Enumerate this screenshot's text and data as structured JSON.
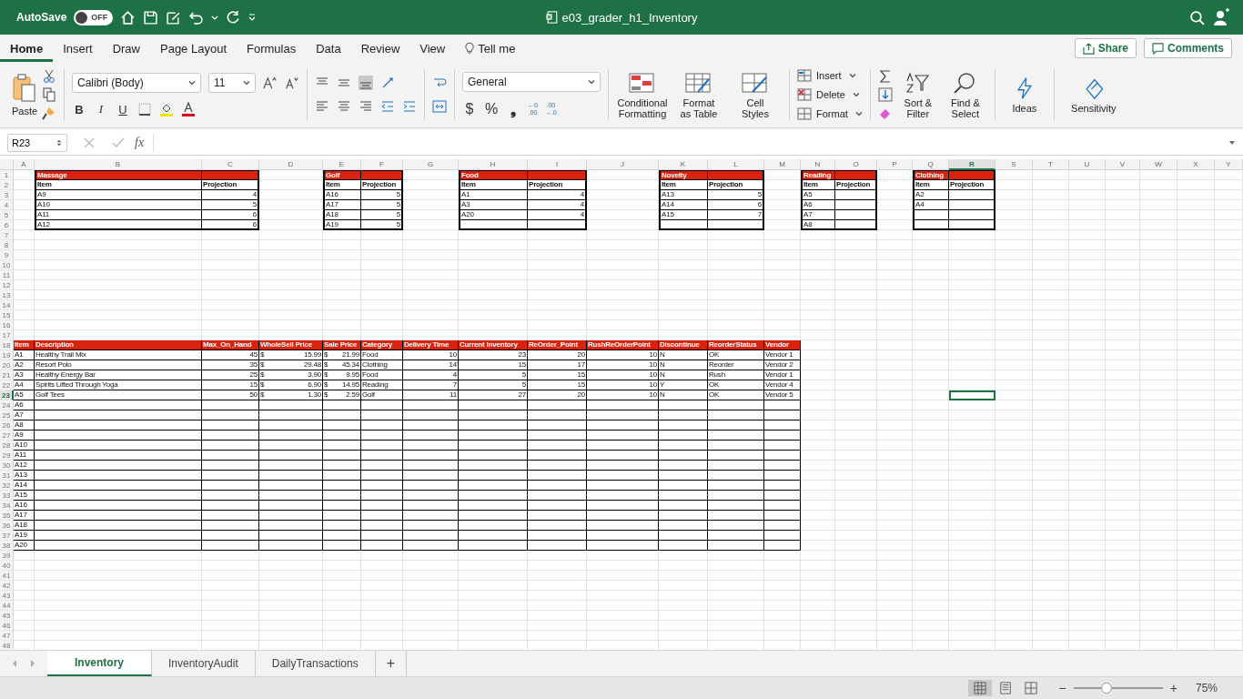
{
  "title_bar": {
    "autosave_label": "AutoSave",
    "autosave": {
      "on": false,
      "label": "OFF"
    },
    "document_title": "e03_grader_h1_Inventory"
  },
  "ribbon_tabs": [
    {
      "label": "Home",
      "selected": true
    },
    {
      "label": "Insert",
      "selected": false
    },
    {
      "label": "Draw",
      "selected": false
    },
    {
      "label": "Page Layout",
      "selected": false
    },
    {
      "label": "Formulas",
      "selected": false
    },
    {
      "label": "Data",
      "selected": false
    },
    {
      "label": "Review",
      "selected": false
    },
    {
      "label": "View",
      "selected": false
    }
  ],
  "tell_me": "Tell me",
  "share": "Share",
  "comments": "Comments",
  "ribbon": {
    "paste": "Paste",
    "font_name": "Calibri (Body)",
    "font_size": "11",
    "bold": "B",
    "italic": "I",
    "underline": "U",
    "number_format": "General",
    "currency": "$",
    "percent": "%",
    "comma": "❟",
    "increase_decimal": {
      "top": "←0",
      "bottom": ".00"
    },
    "decrease_decimal": {
      "top": ".00",
      "bottom": "→.0"
    },
    "style_buttons": [
      {
        "label": "Conditional\nFormatting",
        "kind": "conditional"
      },
      {
        "label": "Format\nas Table",
        "kind": "table"
      },
      {
        "label": "Cell\nStyles",
        "kind": "styles"
      }
    ],
    "cell_buttons": [
      {
        "label": "Insert",
        "kind": "insert"
      },
      {
        "label": "Delete",
        "kind": "delete"
      },
      {
        "label": "Format",
        "kind": "format"
      }
    ],
    "sort_filter": "Sort &\nFilter",
    "find_select": "Find &\nSelect",
    "ideas": "Ideas",
    "sensitivity": "Sensitivity"
  },
  "formula_bar": {
    "name_box": "R23",
    "fx": "fx"
  },
  "sheet": {
    "column_headers": [
      {
        "label": "A",
        "selected": false
      },
      {
        "label": "B",
        "selected": false
      },
      {
        "label": "C",
        "selected": false
      },
      {
        "label": "D",
        "selected": false
      },
      {
        "label": "E",
        "selected": false
      },
      {
        "label": "F",
        "selected": false
      },
      {
        "label": "G",
        "selected": false
      },
      {
        "label": "H",
        "selected": false
      },
      {
        "label": "I",
        "selected": false
      },
      {
        "label": "J",
        "selected": false
      },
      {
        "label": "K",
        "selected": false
      },
      {
        "label": "L",
        "selected": false
      },
      {
        "label": "M",
        "selected": false
      },
      {
        "label": "N",
        "selected": false
      },
      {
        "label": "O",
        "selected": false
      },
      {
        "label": "P",
        "selected": false
      },
      {
        "label": "Q",
        "selected": false
      },
      {
        "label": "R",
        "selected": true
      },
      {
        "label": "S",
        "selected": false
      },
      {
        "label": "T",
        "selected": false
      },
      {
        "label": "U",
        "selected": false
      },
      {
        "label": "V",
        "selected": false
      },
      {
        "label": "W",
        "selected": false
      },
      {
        "label": "X",
        "selected": false
      },
      {
        "label": "Y",
        "selected": false
      }
    ],
    "row_headers": [
      {
        "label": "1",
        "selected": false
      },
      {
        "label": "2",
        "selected": false
      },
      {
        "label": "3",
        "selected": false
      },
      {
        "label": "4",
        "selected": false
      },
      {
        "label": "5",
        "selected": false
      },
      {
        "label": "6",
        "selected": false
      },
      {
        "label": "7",
        "selected": false
      },
      {
        "label": "8",
        "selected": false
      },
      {
        "label": "9",
        "selected": false
      },
      {
        "label": "10",
        "selected": false
      },
      {
        "label": "11",
        "selected": false
      },
      {
        "label": "12",
        "selected": false
      },
      {
        "label": "13",
        "selected": false
      },
      {
        "label": "14",
        "selected": false
      },
      {
        "label": "15",
        "selected": false
      },
      {
        "label": "16",
        "selected": false
      },
      {
        "label": "17",
        "selected": false
      },
      {
        "label": "18",
        "selected": false
      },
      {
        "label": "19",
        "selected": false
      },
      {
        "label": "20",
        "selected": false
      },
      {
        "label": "21",
        "selected": false
      },
      {
        "label": "22",
        "selected": false
      },
      {
        "label": "23",
        "selected": true
      },
      {
        "label": "24",
        "selected": false
      },
      {
        "label": "25",
        "selected": false
      },
      {
        "label": "26",
        "selected": false
      },
      {
        "label": "27",
        "selected": false
      },
      {
        "label": "28",
        "selected": false
      },
      {
        "label": "29",
        "selected": false
      },
      {
        "label": "30",
        "selected": false
      },
      {
        "label": "31",
        "selected": false
      },
      {
        "label": "32",
        "selected": false
      },
      {
        "label": "33",
        "selected": false
      },
      {
        "label": "34",
        "selected": false
      },
      {
        "label": "35",
        "selected": false
      },
      {
        "label": "36",
        "selected": false
      },
      {
        "label": "37",
        "selected": false
      },
      {
        "label": "38",
        "selected": false
      },
      {
        "label": "39",
        "selected": false
      },
      {
        "label": "40",
        "selected": false
      },
      {
        "label": "41",
        "selected": false
      },
      {
        "label": "42",
        "selected": false
      },
      {
        "label": "43",
        "selected": false
      },
      {
        "label": "44",
        "selected": false
      },
      {
        "label": "45",
        "selected": false
      },
      {
        "label": "46",
        "selected": false
      },
      {
        "label": "47",
        "selected": false
      },
      {
        "label": "48",
        "selected": false
      }
    ],
    "category_tables": [
      {
        "title": "Massage",
        "columns": [
          "Item",
          "Projection"
        ],
        "rows": [
          {
            "item": "A9",
            "projection": "4"
          },
          {
            "item": "A10",
            "projection": "5"
          },
          {
            "item": "A11",
            "projection": "6"
          },
          {
            "item": "A12",
            "projection": "6"
          }
        ]
      },
      {
        "title": "Golf",
        "columns": [
          "Item",
          "Projection"
        ],
        "rows": [
          {
            "item": "A16",
            "projection": "5"
          },
          {
            "item": "A17",
            "projection": "5"
          },
          {
            "item": "A18",
            "projection": "5"
          },
          {
            "item": "A19",
            "projection": "5"
          }
        ]
      },
      {
        "title": "Food",
        "columns": [
          "Item",
          "Projection"
        ],
        "rows": [
          {
            "item": "A1",
            "projection": "4"
          },
          {
            "item": "A3",
            "projection": "4"
          },
          {
            "item": "A20",
            "projection": "4"
          }
        ]
      },
      {
        "title": "Novelty",
        "columns": [
          "Item",
          "Projection"
        ],
        "rows": [
          {
            "item": "A13",
            "projection": "5"
          },
          {
            "item": "A14",
            "projection": "6"
          },
          {
            "item": "A15",
            "projection": "7"
          }
        ]
      },
      {
        "title": "Reading",
        "columns": [
          "Item",
          "Projection"
        ],
        "rows": [
          {
            "item": "A5"
          },
          {
            "item": "A6"
          },
          {
            "item": "A7"
          },
          {
            "item": "A8"
          }
        ]
      },
      {
        "title": "Clothing",
        "columns": [
          "Item",
          "Projection"
        ],
        "rows": [
          {
            "item": "A2"
          },
          {
            "item": "A4"
          }
        ]
      }
    ],
    "inventory_table": {
      "columns": [
        {
          "label": "Item",
          "kind": "text"
        },
        {
          "label": "Description",
          "kind": "text"
        },
        {
          "label": "Max_On_Hand",
          "kind": "number"
        },
        {
          "label": "WholeSell Price",
          "kind": "currency"
        },
        {
          "label": "Sale Price",
          "kind": "currency"
        },
        {
          "label": "Category",
          "kind": "text"
        },
        {
          "label": "Delivery Time",
          "kind": "number"
        },
        {
          "label": "Current Inventory",
          "kind": "number"
        },
        {
          "label": "ReOrder_Point",
          "kind": "number"
        },
        {
          "label": "RushReOrderPoint",
          "kind": "number"
        },
        {
          "label": "Discontinue",
          "kind": "text"
        },
        {
          "label": "ReorderStatus",
          "kind": "text"
        },
        {
          "label": "Vendor",
          "kind": "text"
        }
      ],
      "rows": [
        {
          "cells": [
            "A1",
            "Healthy Trail Mix",
            "45",
            {
              "symbol": "$",
              "amount": "15.99"
            },
            {
              "symbol": "$",
              "amount": "21.99"
            },
            "Food",
            "10",
            "23",
            "20",
            "10",
            "N",
            "OK",
            "Vendor 1"
          ]
        },
        {
          "cells": [
            "A2",
            "Resort Polo",
            "35",
            {
              "symbol": "$",
              "amount": "29.48"
            },
            {
              "symbol": "$",
              "amount": "45.34"
            },
            "Clothing",
            "14",
            "15",
            "17",
            "10",
            "N",
            "Reorder",
            "Vendor 2"
          ]
        },
        {
          "cells": [
            "A3",
            "Healthy Energy Bar",
            "25",
            {
              "symbol": "$",
              "amount": "3.90"
            },
            {
              "symbol": "$",
              "amount": "9.95"
            },
            "Food",
            "4",
            "5",
            "15",
            "10",
            "N",
            "Rush",
            "Vendor 1"
          ]
        },
        {
          "cells": [
            "A4",
            "Spirits Lifted Through Yoga",
            "15",
            {
              "symbol": "$",
              "amount": "6.90"
            },
            {
              "symbol": "$",
              "amount": "14.95"
            },
            "Reading",
            "7",
            "5",
            "15",
            "10",
            "Y",
            "OK",
            "Vendor 4"
          ]
        },
        {
          "cells": [
            "A5",
            "Golf Tees",
            "50",
            {
              "symbol": "$",
              "amount": "1.30"
            },
            {
              "symbol": "$",
              "amount": "2.59"
            },
            "Golf",
            "11",
            "27",
            "20",
            "10",
            "N",
            "OK",
            "Vendor 5"
          ]
        },
        {
          "cells": [
            "A6"
          ]
        },
        {
          "cells": [
            "A7"
          ]
        },
        {
          "cells": [
            "A8"
          ]
        },
        {
          "cells": [
            "A9"
          ]
        },
        {
          "cells": [
            "A10"
          ]
        },
        {
          "cells": [
            "A11"
          ]
        },
        {
          "cells": [
            "A12"
          ]
        },
        {
          "cells": [
            "A13"
          ]
        },
        {
          "cells": [
            "A14"
          ]
        },
        {
          "cells": [
            "A15"
          ]
        },
        {
          "cells": [
            "A16"
          ]
        },
        {
          "cells": [
            "A17"
          ]
        },
        {
          "cells": [
            "A18"
          ]
        },
        {
          "cells": [
            "A19"
          ]
        },
        {
          "cells": [
            "A20"
          ]
        }
      ]
    }
  },
  "sheet_tabs": [
    {
      "label": "Inventory",
      "selected": true
    },
    {
      "label": "InventoryAudit",
      "selected": false
    },
    {
      "label": "DailyTransactions",
      "selected": false
    }
  ],
  "add_sheet": "+",
  "status_bar": {
    "zoom_out": "−",
    "zoom_in": "+",
    "zoom_slider": {
      "level": 0.37
    },
    "zoom": "75%"
  }
}
